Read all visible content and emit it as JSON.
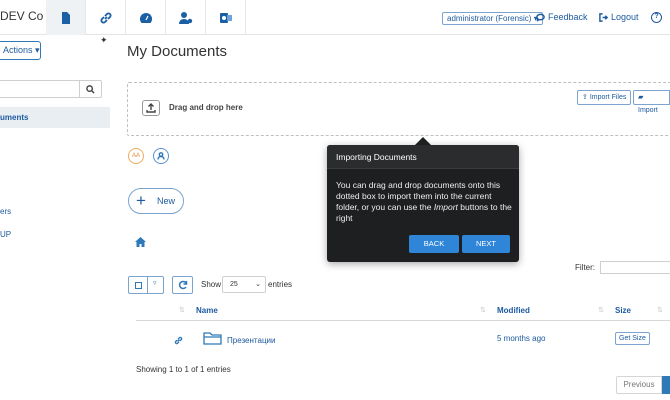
{
  "topbar": {
    "brand": "DEV Co",
    "user_select": "administrator (Forensic) ▾",
    "feedback": "Feedback",
    "logout": "Logout",
    "help": "?"
  },
  "sidebar": {
    "actions_label": "Actions ▾",
    "pin": "✦",
    "items": [
      {
        "label": "uments"
      },
      {
        "label": "ers"
      },
      {
        "label": "UP"
      }
    ]
  },
  "main": {
    "title": "My Documents",
    "dropzone_text": "Drag and drop here",
    "import_files": "Import Files",
    "import": "Import",
    "aa_badge": "AA",
    "new_label": "New",
    "filter_label": "Filter:",
    "show_label": "Show",
    "entries_value": "25",
    "entries_label": "entries",
    "columns": {
      "name": "Name",
      "modified": "Modified",
      "size": "Size"
    },
    "rows": [
      {
        "name": "Презентации",
        "modified": "5 months ago",
        "size_button": "Get Size"
      }
    ],
    "showing": "Showing 1 to 1 of 1 entries",
    "previous": "Previous"
  },
  "tour": {
    "title": "Importing Documents",
    "body_before": "You can drag and drop documents onto this dotted box to import them into the current folder, or you can use the ",
    "body_emph": "Import",
    "body_after": " buttons to the right",
    "back": "BACK",
    "next": "NEXT"
  }
}
